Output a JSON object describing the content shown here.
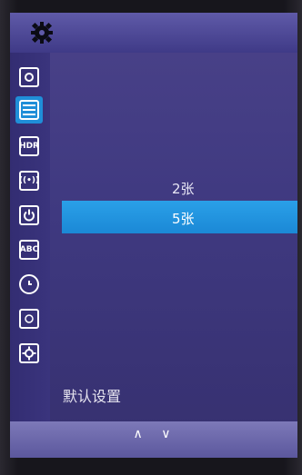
{
  "header": {
    "icon": "gear-icon"
  },
  "sidebar": {
    "items": [
      {
        "icon": "camera-icon"
      },
      {
        "icon": "list-icon",
        "selected": true
      },
      {
        "icon": "hdr-icon",
        "label": "HDR"
      },
      {
        "icon": "broadcast-icon",
        "label": "((•))"
      },
      {
        "icon": "power-icon"
      },
      {
        "icon": "abc-icon",
        "label": "ABC"
      },
      {
        "icon": "clock-icon"
      },
      {
        "icon": "file-icon"
      },
      {
        "icon": "gear-icon"
      }
    ]
  },
  "menu": {
    "options": [
      "2张",
      "5张"
    ],
    "selected": "5张",
    "default_label": "默认设置"
  },
  "footer": {
    "nav": "∧ ∨"
  },
  "colors": {
    "background": "#3f3980",
    "selection": "#1f8ed8",
    "topbar": "#5f5aa8"
  }
}
